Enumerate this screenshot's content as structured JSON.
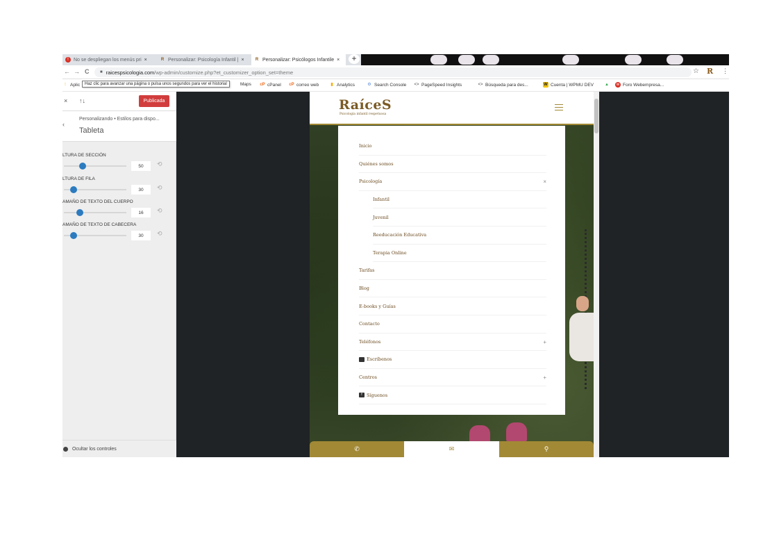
{
  "browser": {
    "tabs": [
      {
        "label": "No se despliegan los menús pri",
        "icon": "error-icon",
        "close": "×"
      },
      {
        "label": "Personalizar: Psicología Infantil |",
        "icon": "raices-favicon",
        "close": "×"
      },
      {
        "label": "Personalizar: Psicólogos Infantile",
        "icon": "raices-favicon",
        "close": "×"
      }
    ],
    "new_tab": "+",
    "url_domain": "raicespsicologia.com",
    "url_path": "/wp-admin/customize.php?et_customizer_option_set=theme",
    "back": "←",
    "forward": "→",
    "reload": "C",
    "star": "☆",
    "profile": "R",
    "menu": "⋮",
    "tooltip": "Haz clic para avanzar una página o pulsa unos segundos para ver el historial",
    "bookmarks": [
      {
        "label": "Aplic",
        "icon": "apps-icon"
      },
      {
        "label": "Maps",
        "icon": "maps-icon"
      },
      {
        "label": "cPanel",
        "icon": "cpanel-icon"
      },
      {
        "label": "correo web",
        "icon": "cpanel-icon"
      },
      {
        "label": "Analytics",
        "icon": "analytics-icon"
      },
      {
        "label": "Search Console",
        "icon": "search-console-icon"
      },
      {
        "label": "PageSpeed Insights",
        "icon": "code-icon"
      },
      {
        "label": "Búsqueda para des...",
        "icon": "code-icon"
      },
      {
        "label": "Cuenta | WPMU DEV",
        "icon": "wpmu-icon"
      },
      {
        "label": "",
        "icon": "ads-icon"
      },
      {
        "label": "Foro Webempresa...",
        "icon": "webempresa-icon"
      }
    ]
  },
  "customizer": {
    "close": "×",
    "sort": "↑↓",
    "publish_label": "Publicada",
    "back": "‹",
    "breadcrumb": "Personalizando • Estilos para dispo...",
    "section_title": "Tableta",
    "reset": "⟲",
    "controls": [
      {
        "label": "LTURA DE SECCIÓN",
        "value": "50",
        "fraction": 0.3
      },
      {
        "label": "LTURA DE FILA",
        "value": "30",
        "fraction": 0.15
      },
      {
        "label": "AMAÑO DE TEXTO DEL CUERPO",
        "value": "16",
        "fraction": 0.25
      },
      {
        "label": "AMAÑO DE TEXTO DE CABECERA",
        "value": "30",
        "fraction": 0.15
      }
    ],
    "hide_controls": "Ocultar los controles"
  },
  "site": {
    "logo": "RaíceS",
    "tagline": "Psicología infantil respetuosa",
    "menu": [
      {
        "label": "Inicio",
        "sub": false,
        "toggle": ""
      },
      {
        "label": "Quiénes somos",
        "sub": false,
        "toggle": ""
      },
      {
        "label": "Psicología",
        "sub": false,
        "toggle": "×"
      },
      {
        "label": "Infantil",
        "sub": true,
        "toggle": ""
      },
      {
        "label": "Juvenil",
        "sub": true,
        "toggle": ""
      },
      {
        "label": "Reeducación Educativa",
        "sub": true,
        "toggle": ""
      },
      {
        "label": "Terapia Online",
        "sub": true,
        "toggle": ""
      },
      {
        "label": "Tarifas",
        "sub": false,
        "toggle": ""
      },
      {
        "label": "Blog",
        "sub": false,
        "toggle": ""
      },
      {
        "label": "E-books y Guías",
        "sub": false,
        "toggle": ""
      },
      {
        "label": "Contacto",
        "sub": false,
        "toggle": ""
      },
      {
        "label": "Teléfonos",
        "sub": false,
        "toggle": "+"
      },
      {
        "label": "Escríbenos",
        "sub": false,
        "toggle": "",
        "icon": "envelope-icon"
      },
      {
        "label": "Centros",
        "sub": false,
        "toggle": "+"
      },
      {
        "label": "Síguenos",
        "sub": false,
        "toggle": "",
        "icon": "facebook-icon"
      }
    ],
    "cta": [
      {
        "icon": "phone-icon",
        "glyph": "✆"
      },
      {
        "icon": "envelope-icon",
        "glyph": "✉"
      },
      {
        "icon": "map-pin-icon",
        "glyph": "⚲"
      }
    ]
  },
  "colors": {
    "accent_gold": "#a28935",
    "publish_red": "#d13d3d",
    "slider_blue": "#2c7bc0",
    "menu_text": "#6b4a1e",
    "preview_bg": "#1f2326"
  }
}
